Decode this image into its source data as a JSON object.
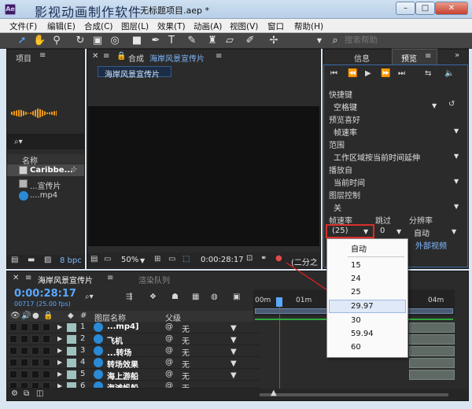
{
  "watermark": "影视动画制作软件",
  "window": {
    "title": "无标题项目.aep *",
    "minimize": "–",
    "maximize": "□",
    "close": "✕"
  },
  "menu": [
    "文件(F)",
    "编辑(E)",
    "合成(C)",
    "图层(L)",
    "效果(T)",
    "动画(A)",
    "视图(V)",
    "窗口",
    "帮助(H)"
  ],
  "toolbar": {
    "search_placeholder": "搜索帮助"
  },
  "project": {
    "tab": "项目",
    "search_icon": "⌕▾",
    "col_name": "名称",
    "items": [
      "Caribbe...",
      "...宣传片",
      "....mp4"
    ],
    "bpc": "8 bpc"
  },
  "comp": {
    "tab_prefix": "合成",
    "tab_name": "海岸风景宣传片",
    "chip": "海岸风景宣传片",
    "zoom": "50%",
    "timecode": "0:00:28:17",
    "resolution": "(二分之",
    "colors": {
      "viewer_bg": "#111111",
      "panel_bg": "#2b2b2b"
    }
  },
  "info_panel": {
    "tab_info": "信息",
    "tab_preview": "预览"
  },
  "preview": {
    "shortcut_label": "快捷键",
    "shortcut_value": "空格键",
    "pref_label": "预览喜好",
    "pref_value": "帧速率",
    "range_label": "范围",
    "range_value": "工作区域按当前时间延伸",
    "play_from_label": "播放自",
    "play_from_value": "当前时间",
    "layer_ctrl_label": "图层控制",
    "layer_ctrl_value": "关",
    "fps_label": "帧速率",
    "skip_label": "跳过",
    "res_label": "分辨率",
    "fps_value": "(25)",
    "skip_value": "0",
    "res_value": "自动",
    "ext_label": "外部视频"
  },
  "fps_dropdown": {
    "options": [
      "自动",
      "15",
      "24",
      "25",
      "29.97",
      "30",
      "59.94",
      "60"
    ],
    "selected": "29.97"
  },
  "timeline": {
    "tab_comp": "海岸风景宣传片",
    "tab_render": "渲染队列",
    "timecode": "0:00:28:17",
    "frames": "00717 (25.00 fps)",
    "ruler": [
      "00m",
      "01m",
      "04m"
    ],
    "col_layer_name": "图层名称",
    "col_parent": "父级",
    "layers": [
      {
        "num": "1",
        "name": "...mp4]",
        "parent": "无"
      },
      {
        "num": "2",
        "name": "飞机",
        "parent": "无"
      },
      {
        "num": "3",
        "name": "...转场",
        "parent": "无"
      },
      {
        "num": "4",
        "name": "转场效果",
        "parent": "无"
      },
      {
        "num": "5",
        "name": "海上游船",
        "parent": "无"
      },
      {
        "num": "6",
        "name": "海滩帆船",
        "parent": "无"
      }
    ]
  }
}
